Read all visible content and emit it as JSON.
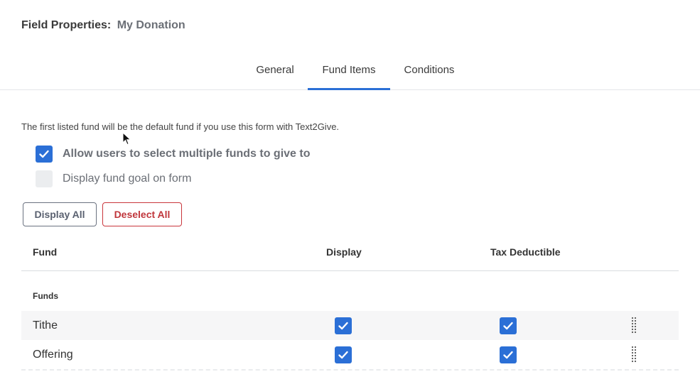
{
  "header": {
    "title_label": "Field Properties:",
    "title_value": "My Donation"
  },
  "tabs": [
    {
      "label": "General",
      "active": false
    },
    {
      "label": "Fund Items",
      "active": true
    },
    {
      "label": "Conditions",
      "active": false
    }
  ],
  "info_text": "The first listed fund will be the default fund if you use this form with Text2Give.",
  "options": [
    {
      "label": "Allow users to select multiple funds to give to",
      "checked": true
    },
    {
      "label": "Display fund goal on form",
      "checked": false
    }
  ],
  "buttons": {
    "display_all": "Display All",
    "deselect_all": "Deselect All"
  },
  "table": {
    "headers": {
      "fund": "Fund",
      "display": "Display",
      "tax": "Tax Deductible"
    },
    "group_label": "Funds",
    "rows": [
      {
        "name": "Tithe",
        "display": true,
        "tax_deductible": true
      },
      {
        "name": "Offering",
        "display": true,
        "tax_deductible": true
      }
    ]
  },
  "colors": {
    "accent": "#2b6fd6",
    "danger": "#c0363b",
    "row_alt": "#f6f6f7"
  },
  "icons": {
    "checkbox_check": "check-icon",
    "row_handle": "drag-handle-icon",
    "pointer": "cursor-arrow-icon"
  }
}
